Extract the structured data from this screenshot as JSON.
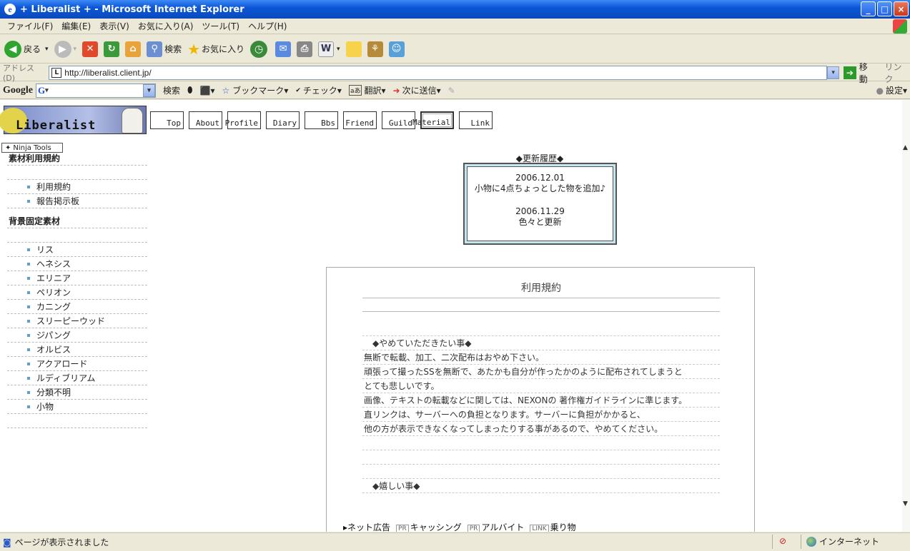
{
  "window": {
    "title": "+ Liberalist + - Microsoft Internet Explorer",
    "logo_letter": "e",
    "btn_min": "_",
    "btn_max": "□",
    "btn_close": "×"
  },
  "menu": [
    "ファイル(F)",
    "編集(E)",
    "表示(V)",
    "お気に入り(A)",
    "ツール(T)",
    "ヘルプ(H)"
  ],
  "toolbar": {
    "back": "戻る",
    "search": "検索",
    "favorites": "お気に入り",
    "dd": "▾"
  },
  "address": {
    "label": "アドレス(D)",
    "url": "http://liberalist.client.jp/",
    "fav_letter": "L",
    "go": "移動",
    "links": "リンク",
    "dd": "▾"
  },
  "google": {
    "logo": "Google",
    "box_letter": "G",
    "search": "検索",
    "bookmark": "ブックマーク",
    "check": "チェック",
    "translate": "翻訳",
    "send": "次に送信",
    "settings": "設定"
  },
  "site": {
    "banner_text": "Liberalist",
    "nav": [
      "Top",
      "About",
      "Profile",
      "Diary",
      "Bbs",
      "Friend",
      "Guild",
      "Material",
      "Link"
    ],
    "ninja": "Ninja Tools",
    "sidebar": {
      "head1": "素材利用規約",
      "group1": [
        "利用規約",
        "報告掲示板"
      ],
      "head2": "背景固定素材",
      "group2": [
        "リス",
        "ヘネシス",
        "エリニア",
        "ペリオン",
        "カニング",
        "スリーピーウッド",
        "ジパング",
        "オルビス",
        "アクアロード",
        "ルディブリアム",
        "分類不明",
        "小物"
      ]
    },
    "news": {
      "title": "◆更新履歴◆",
      "entries": [
        {
          "date": "2006.12.01",
          "text": "小物に4点ちょっとした物を追加♪"
        },
        {
          "date": "2006.11.29",
          "text": "色々と更新"
        }
      ]
    },
    "terms": {
      "title": "利用規約",
      "lines": [
        "",
        "◆やめていただきたい事◆",
        "無断で転載、加工、二次配布はおやめ下さい。",
        "頑張って撮ったSSを無断で、あたかも自分が作ったかのように配布されてしまうと",
        "とても悲しいです。",
        "画像、テキストの転載などに関しては、NEXONの 著作権ガイドラインに準じます。",
        "直リンクは、サーバーへの負担となります。サーバーに負担がかかると、",
        "他の方が表示できなくなってしまったりする事があるので、やめてください。",
        "",
        "",
        "",
        "◆嬉しい事◆"
      ]
    },
    "footer": {
      "ad": "ネット広告",
      "pr1": "PR",
      "item1": "キャッシング",
      "pr2": "PR",
      "item2": "アルバイト",
      "pr3": "LINK",
      "item3": "乗り物"
    }
  },
  "status": {
    "text": "ページが表示されました",
    "zone": "インターネット"
  }
}
